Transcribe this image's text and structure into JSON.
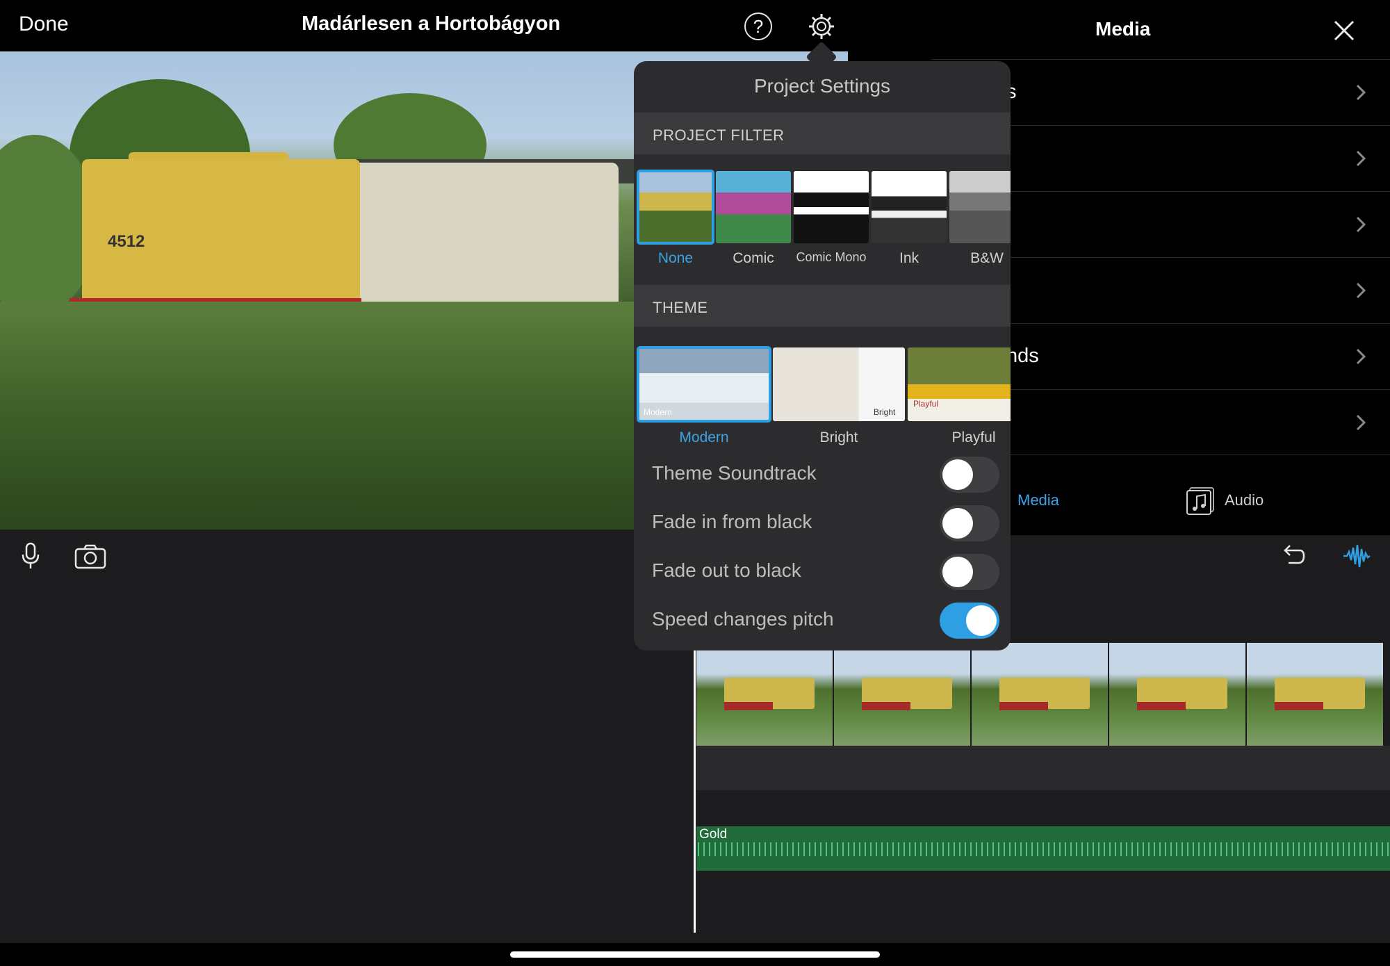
{
  "header": {
    "done_label": "Done",
    "project_title": "Madárlesen a Hortobágyon",
    "help_glyph": "?"
  },
  "viewer": {
    "locomotive_plate": "4512"
  },
  "media_panel": {
    "title": "Media",
    "rows": [
      {
        "label": "s"
      },
      {
        "label": ""
      },
      {
        "label": ""
      },
      {
        "label": ""
      },
      {
        "label": "nds"
      },
      {
        "label": ""
      }
    ],
    "tabs": {
      "media_label": "Media",
      "audio_label": "Audio"
    }
  },
  "timeline": {
    "audio_clip_label": "Gold",
    "clip_count": 5
  },
  "project_settings": {
    "title": "Project Settings",
    "filter_section": "PROJECT FILTER",
    "filters": [
      {
        "label": "None",
        "selected": true
      },
      {
        "label": "Comic",
        "selected": false
      },
      {
        "label": "Comic Mono",
        "selected": false
      },
      {
        "label": "Ink",
        "selected": false
      },
      {
        "label": "B&W",
        "selected": false
      }
    ],
    "theme_section": "THEME",
    "themes": [
      {
        "label": "Modern",
        "tag": "Modern",
        "selected": true
      },
      {
        "label": "Bright",
        "tag": "Bright",
        "selected": false
      },
      {
        "label": "Playful",
        "tag": "Playful",
        "selected": false
      }
    ],
    "toggles": [
      {
        "label": "Theme Soundtrack",
        "on": false
      },
      {
        "label": "Fade in from black",
        "on": false
      },
      {
        "label": "Fade out to black",
        "on": false
      },
      {
        "label": "Speed changes pitch",
        "on": true
      }
    ]
  },
  "colors": {
    "accent": "#2f9fe4",
    "audio_track": "#1f6b3a",
    "popover_bg": "#2c2c2e"
  }
}
